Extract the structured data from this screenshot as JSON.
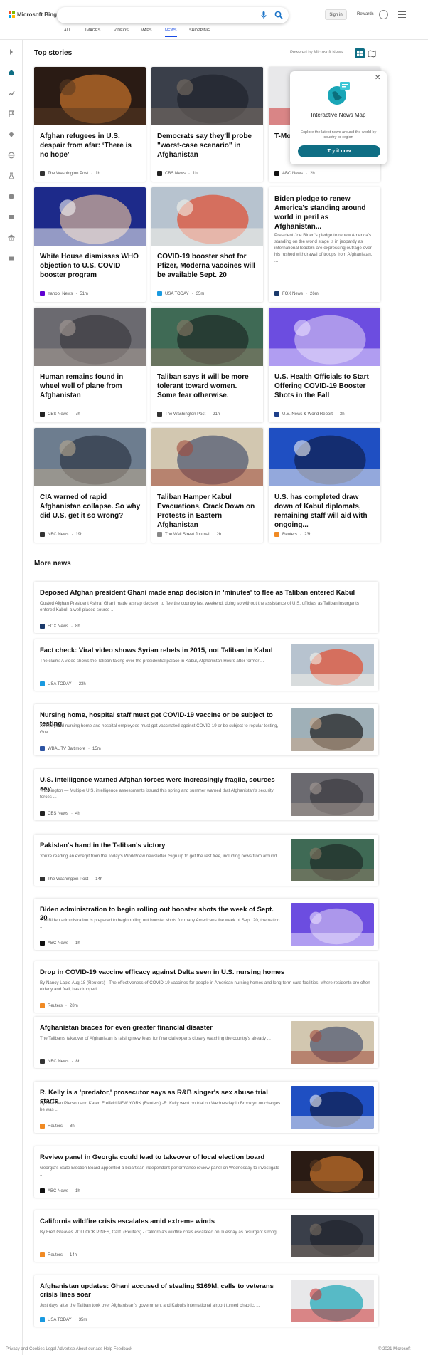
{
  "brand": {
    "name": "Microsoft Bing"
  },
  "header": {
    "signin_label": "Sign in",
    "rewards_label": "Rewards"
  },
  "tabs": [
    "ALL",
    "IMAGES",
    "VIDEOS",
    "MAPS",
    "NEWS",
    "SHOPPING"
  ],
  "active_tab": "NEWS",
  "top_stories": {
    "title": "Top stories",
    "powered_by": "Powered by Microsoft News",
    "cards": [
      {
        "title": "Afghan refugees in U.S. despair from afar: ‘There is no hope’",
        "source": "The Washington Post",
        "time": "1h"
      },
      {
        "title": "Democrats say they'll probe \"worst-case scenario\" in Afghanistan",
        "source": "CBS News",
        "time": "1h"
      },
      {
        "title": "T-Mo expo than",
        "source": "ABC News",
        "time": "2h"
      },
      {
        "title": "White House dismisses WHO objection to U.S. COVID booster program",
        "source": "Yahoo! News",
        "time": "51m"
      },
      {
        "title": "COVID-19 booster shot for Pfizer, Moderna vaccines will be available Sept. 20",
        "source": "USA TODAY",
        "time": "35m"
      },
      {
        "title": "Biden pledge to renew America's standing around world in peril as Afghanistan...",
        "desc": "President Joe Biden's pledge to renew America's standing on the world stage is in jeopardy as international leaders are expressing outrage over his rushed withdrawal of troops from Afghanistan, ...",
        "source": "FOX News",
        "time": "26m"
      },
      {
        "title": "Human remains found in wheel well of plane from Afghanistan",
        "source": "CBS News",
        "time": "7h"
      },
      {
        "title": "Taliban says it will be more tolerant toward women. Some fear otherwise.",
        "source": "The Washington Post",
        "time": "21h"
      },
      {
        "title": "U.S. Health Officials to Start Offering COVID-19 Booster Shots in the Fall",
        "source": "U.S. News & World Report",
        "time": "3h"
      },
      {
        "title": "CIA warned of rapid Afghanistan collapse. So why did U.S. get it so wrong?",
        "source": "NBC News",
        "time": "19h"
      },
      {
        "title": "Taliban Hamper Kabul Evacuations, Crack Down on Protests in Eastern Afghanistan",
        "source": "The Wall Street Journal",
        "time": "2h"
      },
      {
        "title": "U.S. has completed draw down of Kabul diplomats, remaining staff will aid with ongoing...",
        "source": "Reuters",
        "time": "23h"
      }
    ]
  },
  "popup": {
    "close": "✕",
    "title": "Interactive News Map",
    "desc": "Explore the latest news around the world by country or region",
    "button": "Try it now"
  },
  "more_news": {
    "title": "More news",
    "items": [
      {
        "title": "Deposed Afghan president Ghani made snap decision in 'minutes' to flee as Taliban entered Kabul",
        "desc": "Ousted Afghan President Ashraf Ghani made a snap decision to flee the country last weekend, doing so without the assistance of U.S. officials as Taliban insurgents entered Kabul, a well-placed source ...",
        "source": "FOX News",
        "time": "8h"
      },
      {
        "title": "Fact check: Viral video shows Syrian rebels in 2015, not Taliban in Kabul",
        "desc": "The claim: A video shows the Taliban taking over the presidential palace in Kabul, Afghanistan Hours after former ...",
        "source": "USA TODAY",
        "time": "23h"
      },
      {
        "title": "Nursing home, hospital staff must get COVID-19 vaccine or be subject to testing",
        "desc": "All Maryland nursing home and hospital employees must get vaccinated against COVID-19 or be subject to regular testing, Gov.",
        "source": "WBAL TV Baltimore",
        "time": "15m"
      },
      {
        "title": "U.S. intelligence warned Afghan forces were increasingly fragile, sources say",
        "desc": "Washington — Multiple U.S. intelligence assessments issued this spring and summer warned that Afghanistan's security forces ...",
        "source": "CBS News",
        "time": "4h"
      },
      {
        "title": "Pakistan's hand in the Taliban's victory",
        "desc": "You're reading an excerpt from the Today's WorldView newsletter. Sign up to get the rest free, including news from around ...",
        "source": "The Washington Post",
        "time": "14h"
      },
      {
        "title": "Biden administration to begin rolling out booster shots the week of Sept. 20",
        "desc": "The Biden administration is prepared to begin rolling out booster shots for many Americans the week of Sept. 20, the nation ...",
        "source": "ABC News",
        "time": "1h"
      },
      {
        "title": "Drop in COVID-19 vaccine efficacy against Delta seen in U.S. nursing homes",
        "desc": "By Nancy Lapid Aug 18 (Reuters) - The effectiveness of COVID-19 vaccines for people in American nursing homes and long-term care facilities, where residents are often elderly and frail, has dropped ...",
        "source": "Reuters",
        "time": "28m"
      },
      {
        "title": "Afghanistan braces for even greater financial disaster",
        "desc": "The Taliban's takeover of Afghanistan is raising new fears for financial experts closely watching the country's already ...",
        "source": "NBC News",
        "time": "8h"
      },
      {
        "title": "R. Kelly is a 'predator,' prosecutor says as R&B singer's sex abuse trial starts",
        "desc": "By Brendan Pierson and Karen Freifeld NEW YORK (Reuters) -R. Kelly went on trial on Wednesday in Brooklyn on charges he was ...",
        "source": "Reuters",
        "time": "8h"
      },
      {
        "title": "Review panel in Georgia could lead to takeover of local election board",
        "desc": "Georgia's State Election Board appointed a bipartisan independent performance review panel on Wednesday to investigate ...",
        "source": "ABC News",
        "time": "1h"
      },
      {
        "title": "California wildfire crisis escalates amid extreme winds",
        "desc": "By Fred Greaves POLLOCK PINES, Calif. (Reuters) - California's wildfire crisis escalated on Tuesday as resurgent strong ...",
        "source": "Reuters",
        "time": "14h"
      },
      {
        "title": "Afghanistan updates: Ghani accused of stealing $169M, calls to veterans crisis lines soar",
        "desc": "Just days after the Taliban took over Afghanistan's government and Kabul's international airport turned chaotic, ...",
        "source": "USA TODAY",
        "time": "35m"
      }
    ]
  },
  "footer": {
    "left": "Privacy and Cookies   Legal   Advertise   About our ads   Help   Feedback",
    "right": "© 2021 Microsoft"
  },
  "colors": {
    "accent": "#174ae4",
    "teal": "#0f6e84",
    "popup_icon": "#1aa6b7"
  }
}
